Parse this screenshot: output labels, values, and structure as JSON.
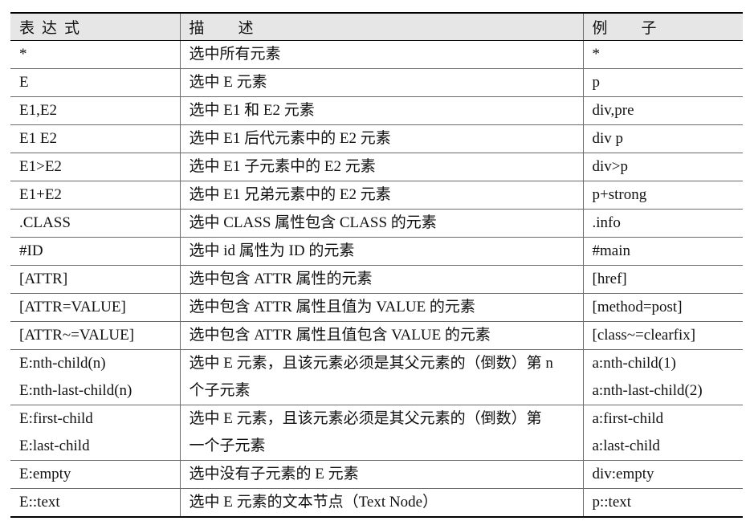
{
  "table": {
    "headers": {
      "expression": "表达式",
      "description": "描述",
      "example": "例子"
    },
    "rows": [
      {
        "expr": [
          "*"
        ],
        "desc": [
          "选中所有元素"
        ],
        "example": [
          "*"
        ]
      },
      {
        "expr": [
          "E"
        ],
        "desc": [
          "选中 E 元素"
        ],
        "example": [
          "p"
        ]
      },
      {
        "expr": [
          "E1,E2"
        ],
        "desc": [
          "选中 E1 和 E2 元素"
        ],
        "example": [
          "div,pre"
        ]
      },
      {
        "expr": [
          "E1 E2"
        ],
        "desc": [
          "选中 E1 后代元素中的 E2 元素"
        ],
        "example": [
          "div p"
        ]
      },
      {
        "expr": [
          "E1>E2"
        ],
        "desc": [
          "选中 E1 子元素中的 E2 元素"
        ],
        "example": [
          "div>p"
        ]
      },
      {
        "expr": [
          "E1+E2"
        ],
        "desc": [
          "选中 E1 兄弟元素中的 E2 元素"
        ],
        "example": [
          "p+strong"
        ]
      },
      {
        "expr": [
          ".CLASS"
        ],
        "desc": [
          "选中 CLASS 属性包含 CLASS 的元素"
        ],
        "example": [
          ".info"
        ]
      },
      {
        "expr": [
          "#ID"
        ],
        "desc": [
          "选中 id 属性为 ID 的元素"
        ],
        "example": [
          "#main"
        ]
      },
      {
        "expr": [
          "[ATTR]"
        ],
        "desc": [
          "选中包含 ATTR 属性的元素"
        ],
        "example": [
          "[href]"
        ]
      },
      {
        "expr": [
          "[ATTR=VALUE]"
        ],
        "desc": [
          "选中包含 ATTR 属性且值为 VALUE 的元素"
        ],
        "example": [
          "[method=post]"
        ]
      },
      {
        "expr": [
          "[ATTR~=VALUE]"
        ],
        "desc": [
          "选中包含 ATTR 属性且值包含 VALUE 的元素"
        ],
        "example": [
          "[class~=clearfix]"
        ]
      },
      {
        "expr": [
          "E:nth-child(n)",
          "E:nth-last-child(n)"
        ],
        "desc": [
          "选中 E 元素，且该元素必须是其父元素的（倒数）第 n",
          "个子元素"
        ],
        "example": [
          "a:nth-child(1)",
          "a:nth-last-child(2)"
        ]
      },
      {
        "expr": [
          "E:first-child",
          "E:last-child"
        ],
        "desc": [
          "选中 E 元素，且该元素必须是其父元素的（倒数）第",
          "一个子元素"
        ],
        "example": [
          "a:first-child",
          "a:last-child"
        ]
      },
      {
        "expr": [
          "E:empty"
        ],
        "desc": [
          "选中没有子元素的 E 元素"
        ],
        "example": [
          "div:empty"
        ]
      },
      {
        "expr": [
          "E::text"
        ],
        "desc": [
          "选中 E 元素的文本节点（Text Node）"
        ],
        "example": [
          "p::text"
        ]
      }
    ]
  }
}
